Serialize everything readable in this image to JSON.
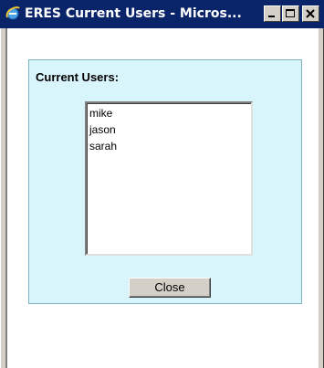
{
  "window": {
    "title": "ERES Current Users - Micros...",
    "controls": [
      "minimize-icon",
      "maximize-icon",
      "close-icon"
    ],
    "titlebar_color": "#0a246a"
  },
  "panel": {
    "heading": "Current Users:",
    "background": "#d9f5fc",
    "users": [
      "mike",
      "jason",
      "sarah"
    ],
    "close_label": "Close"
  }
}
